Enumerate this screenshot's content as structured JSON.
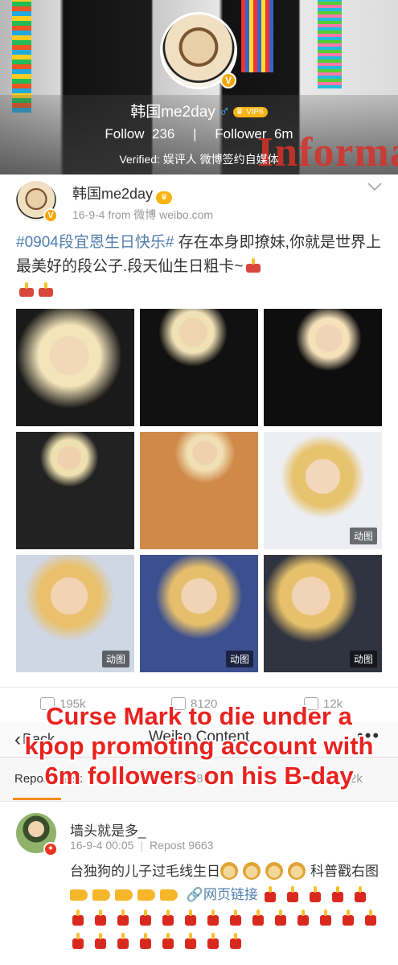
{
  "profile": {
    "name": "韩国me2day",
    "gender_icon": "♂",
    "vip_label": "VIP6",
    "verified_badge": "V",
    "follow_label": "Follow",
    "follow_count": "236",
    "separator": "|",
    "follower_label": "Follower",
    "follower_count": "6m",
    "verified_text": "Verified: 娱评人 微博签约自媒体",
    "banner_text": "Information"
  },
  "post": {
    "author": "韩国me2day",
    "meta": "16-9-4  from 微博 weibo.com",
    "hashtag": "#0904段宜恩生日快乐#",
    "body": " 存在本身即撩妹,你就是世界上最美好的段公子.段天仙生日粗卡~",
    "gif_label": "动图",
    "images": [
      "photo-1",
      "photo-2",
      "photo-3",
      "photo-4",
      "photo-5",
      "photo-6",
      "photo-7",
      "photo-8",
      "photo-9"
    ],
    "reposts": "195k",
    "comments": "8120",
    "likes": "12k"
  },
  "navbar": {
    "back_label": "Back",
    "title": "Weibo Content",
    "more_icon": "•••"
  },
  "tabs": {
    "repost": "Repost 195k",
    "comment": "Comment 8120",
    "like": "Like 12k"
  },
  "comment": {
    "author": "墙头就是多_",
    "time": "16-9-4 00:05",
    "repost": "Repost 9663",
    "text_start": "台独狗的儿子过毛线生日",
    "text_mid": "科普戳右图",
    "link_text": "网页链接"
  },
  "caption": {
    "line1": "Curse Mark to die under a",
    "line2": "kpop promoting account with",
    "line3": "6m followers on his B-day"
  },
  "colors": {
    "link": "#507daf",
    "caption_red": "#e8231f",
    "tab_accent": "#f78c21",
    "vip_gold": "#f9b312"
  }
}
